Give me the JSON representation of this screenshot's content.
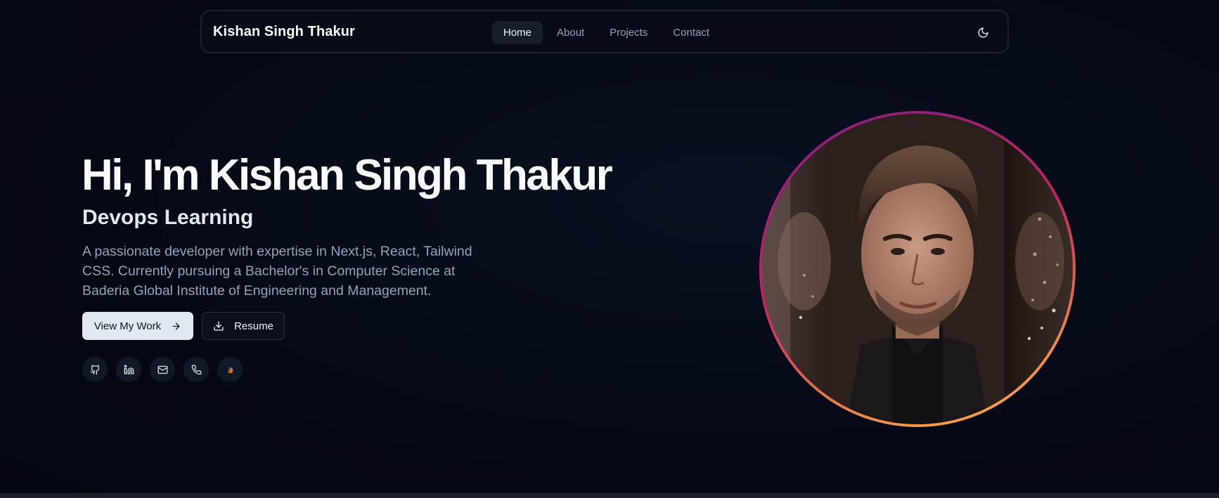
{
  "navbar": {
    "brand": "Kishan Singh Thakur",
    "links": [
      {
        "label": "Home",
        "active": true
      },
      {
        "label": "About",
        "active": false
      },
      {
        "label": "Projects",
        "active": false
      },
      {
        "label": "Contact",
        "active": false
      }
    ],
    "theme_toggle_icon": "moon-icon"
  },
  "hero": {
    "title": "Hi, I'm Kishan Singh Thakur",
    "subtitle": "Devops Learning",
    "description": "A passionate developer with expertise in Next.js, React, Tailwind CSS. Currently pursuing a Bachelor's in Computer Science at Baderia Global Institute of Engineering and Management.",
    "primary_button": {
      "label": "View My Work",
      "icon": "arrow-right-icon"
    },
    "secondary_button": {
      "label": "Resume",
      "icon": "download-icon"
    },
    "socials": [
      "github-icon",
      "linkedin-icon",
      "mail-icon",
      "phone-icon",
      "stackoverflow-icon"
    ]
  },
  "portrait": {
    "icon": "profile-photo",
    "ring_colors": [
      "#7e1f86",
      "#c0265f",
      "#f08a4a",
      "#fbb450"
    ]
  },
  "colors": {
    "background": "#050915",
    "primary_button_bg": "#e2e8f0",
    "muted_text": "#94a3b8"
  }
}
